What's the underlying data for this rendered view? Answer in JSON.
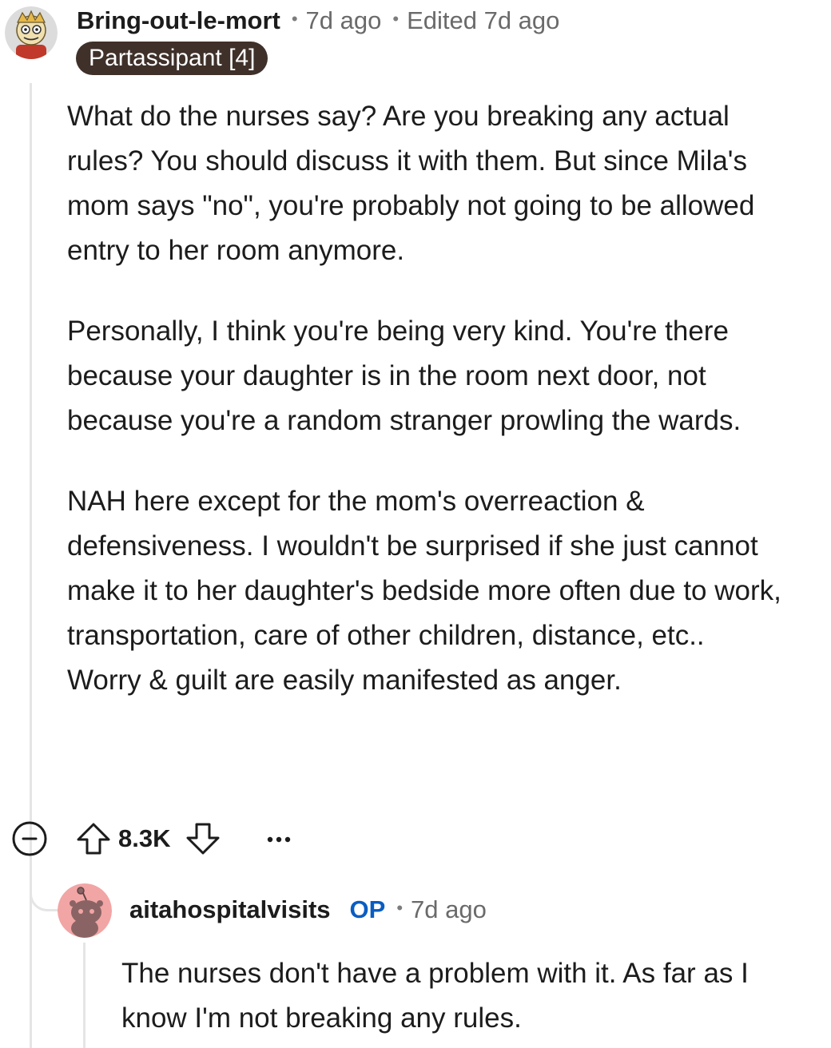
{
  "comment": {
    "username": "Bring-out-le-mort",
    "posted": "7d ago",
    "edited": "Edited 7d ago",
    "separator": "•",
    "flair": "Partassipant [4]",
    "avatar_icon": "cartoon-avatar-icon",
    "paragraphs": [
      "What do the nurses say? Are you breaking any actual rules? You should discuss it with them. But since Mila's mom says \"no\", you're probably not going to be allowed entry to her room anymore.",
      "Personally, I think you're being very kind. You're there because your daughter is in the room next door, not because you're a random stranger prowling the wards.",
      "NAH here except for the mom's overreaction & defensiveness. I wouldn't be surprised if she just cannot make it to her daughter's bedside more often due to work, transportation, care of other children, distance, etc.. Worry & guilt are easily manifested as anger."
    ],
    "actions": {
      "collapse_icon": "minus-circle-icon",
      "upvote_icon": "arrow-up-icon",
      "score": "8.3K",
      "downvote_icon": "arrow-down-icon",
      "more_icon": "more-horizontal-icon"
    }
  },
  "reply": {
    "username": "aitahospitalvisits",
    "op_label": "OP",
    "separator": "•",
    "posted": "7d ago",
    "avatar_icon": "snoo-avatar-icon",
    "text": "The nurses don't have a problem with it. As far as I know I'm not breaking any rules."
  },
  "colors": {
    "flair_bg": "#3f302a",
    "op_blue": "#0a5dc2",
    "meta_gray": "#6a6a6a",
    "thread_line": "#e5e5e5",
    "reply_avatar_bg": "#f2a5a5"
  }
}
